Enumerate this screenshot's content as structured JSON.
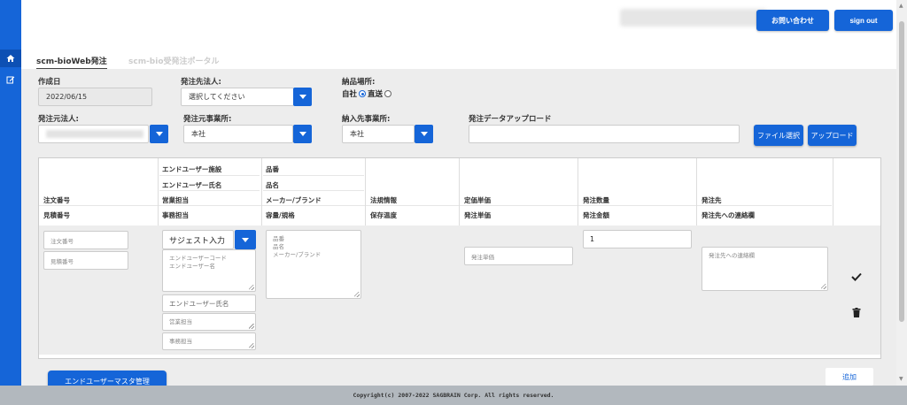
{
  "header": {
    "contact_label": "お問い合わせ",
    "signout_label": "sign out"
  },
  "sidebar": {
    "items": [
      {
        "icon": "home-icon"
      },
      {
        "icon": "edit-icon"
      }
    ]
  },
  "tabs": [
    {
      "label": "scm-bioWeb発注",
      "active": true
    },
    {
      "label": "scm-bio受発注ポータル",
      "active": false
    }
  ],
  "form": {
    "created_date_label": "作成日",
    "created_date_value": "2022/06/15",
    "supplier_label": "発注先法人:",
    "supplier_value": "選択してください",
    "delivery_label": "納品場所:",
    "delivery_option1": "自社",
    "delivery_option2": "直送",
    "orderer_label": "発注元法人:",
    "orderer_office_label": "発注元事業所:",
    "orderer_office_value": "本社",
    "delivery_office_label": "納入先事業所:",
    "delivery_office_value": "本社",
    "upload_label": "発注データアップロード",
    "file_select_label": "ファイル選択",
    "upload_button_label": "アップロード"
  },
  "table": {
    "headers": {
      "col1": [
        "注文番号",
        "見積番号"
      ],
      "col2": [
        "エンドユーザー施設",
        "エンドユーザー氏名",
        "営業担当",
        "事務担当"
      ],
      "col3": [
        "品番",
        "品名",
        "メーカー/ブランド",
        "容量/規格"
      ],
      "col4": [
        "法規情報",
        "保存温度"
      ],
      "col5": [
        "定価単価",
        "発注単価"
      ],
      "col6": [
        "発注数量",
        "発注金額"
      ],
      "col7": [
        "発注先",
        "発注先への連絡欄"
      ]
    },
    "row": {
      "order_no_placeholder": "注文番号",
      "quote_no_placeholder": "見積番号",
      "suggest_label": "サジェスト入力",
      "enduser_area": [
        "エンドユーザーコード",
        "エンドユーザー名"
      ],
      "enduser_name_placeholder": "エンドユーザー氏名",
      "sales_placeholder": "営業担当",
      "admin_placeholder": "事務担当",
      "product_area": [
        "品番",
        "品名",
        "メーカー/ブランド"
      ],
      "unit_price_placeholder": "発注単価",
      "quantity_value": "1",
      "note_placeholder": "発注先への連絡欄"
    }
  },
  "bottom": {
    "master_button_label": "エンドユーザーマスタ管理",
    "add_label": "追加"
  },
  "footer": {
    "copyright": "Copyright(c) 2007-2022 SAGBRAIN Corp. All rights reserved."
  },
  "colors": {
    "accent": "#1565d8",
    "content_bg": "#ededed",
    "footer_bg": "#b2b8be"
  }
}
